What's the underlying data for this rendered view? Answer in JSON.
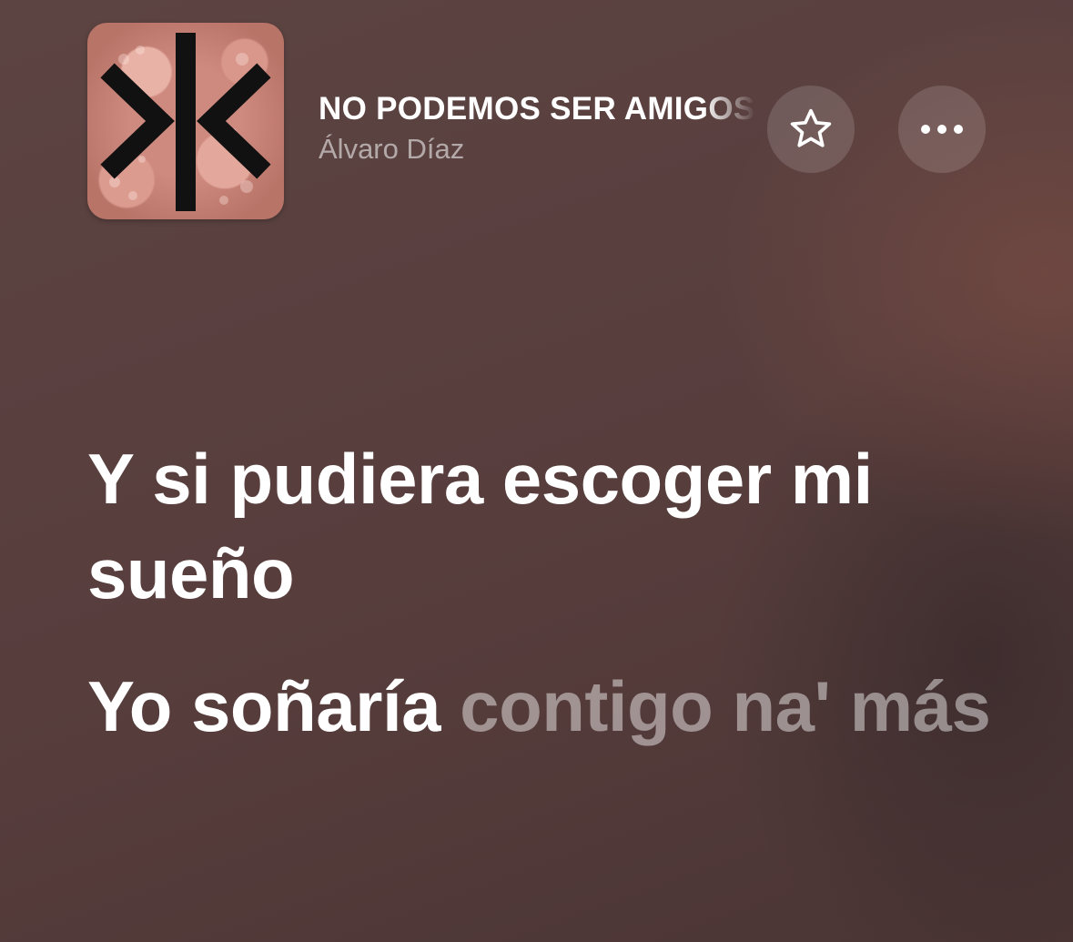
{
  "now_playing": {
    "title": "NO PODEMOS SER AMIGOS",
    "artist": "Álvaro Díaz",
    "artwork_icon": "album-artwork-octopus"
  },
  "controls": {
    "favorite_icon": "star-icon",
    "more_icon": "ellipsis-icon"
  },
  "lyrics": {
    "line1": {
      "sung": "Y si pudiera escoger mi sueño"
    },
    "line2": {
      "sung": "Yo soñaría",
      "unsung": " contigo na' más"
    }
  },
  "colors": {
    "background": "#573e3d",
    "text_active": "#ffffff",
    "text_inactive": "rgba(255,255,255,0.45)",
    "button_bg": "rgba(255,255,255,0.14)"
  }
}
